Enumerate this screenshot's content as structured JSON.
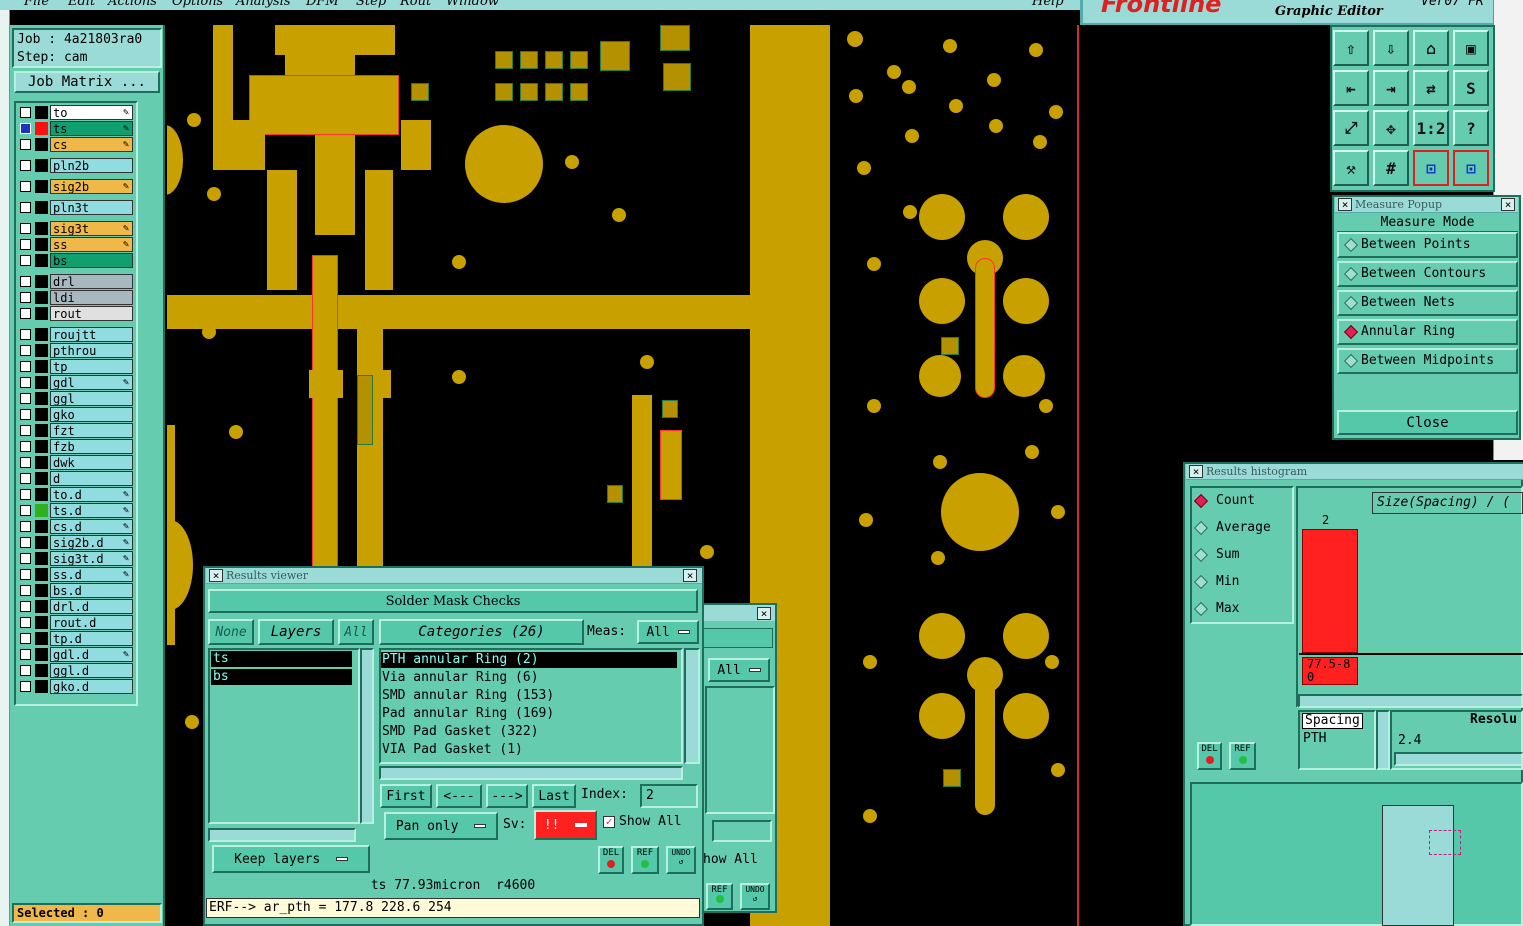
{
  "menu": {
    "items": [
      "File",
      "Edit",
      "Actions",
      "Options",
      "Analysis",
      "DFM",
      "Step",
      "Rout",
      "Window"
    ],
    "help": "Help",
    "brand": "Frontline",
    "brand_sub": "Graphic Editor",
    "version": "Ver07 FR"
  },
  "job": {
    "job_label": "Job : 4a21803ra0",
    "step_label": "Step: cam",
    "matrix_button": "Job Matrix ...",
    "selected": "Selected : 0"
  },
  "layers": [
    {
      "name": "to",
      "color": "#ffffff",
      "edit": true
    },
    {
      "name": "ts",
      "color": "#10a070",
      "edit": true,
      "selected": true
    },
    {
      "name": "cs",
      "color": "#f0b848",
      "edit": true
    },
    {
      "name": "pln2b",
      "color": "#90dce0",
      "edit": false
    },
    {
      "name": "sig2b",
      "color": "#f0b848",
      "edit": true
    },
    {
      "name": "pln3t",
      "color": "#90dce0",
      "edit": false
    },
    {
      "name": "sig3t",
      "color": "#f0b848",
      "edit": true
    },
    {
      "name": "ss",
      "color": "#f0b848",
      "edit": true
    },
    {
      "name": "bs",
      "color": "#10a070",
      "edit": false
    },
    {
      "name": "drl",
      "color": "#a8b8c0",
      "edit": false
    },
    {
      "name": "ldi",
      "color": "#a8b8c0",
      "edit": false
    },
    {
      "name": "rout",
      "color": "#e0e0e0",
      "edit": false
    },
    {
      "name": "roujtt",
      "color": "#90dce0",
      "edit": false
    },
    {
      "name": "pthrou",
      "color": "#90dce0",
      "edit": false
    },
    {
      "name": "tp",
      "color": "#90dce0",
      "edit": false
    },
    {
      "name": "gdl",
      "color": "#90dce0",
      "edit": true
    },
    {
      "name": "ggl",
      "color": "#90dce0",
      "edit": false
    },
    {
      "name": "gko",
      "color": "#90dce0",
      "edit": false
    },
    {
      "name": "fzt",
      "color": "#90dce0",
      "edit": false
    },
    {
      "name": "fzb",
      "color": "#90dce0",
      "edit": false
    },
    {
      "name": "dwk",
      "color": "#90dce0",
      "edit": false
    },
    {
      "name": "d",
      "color": "#90dce0",
      "edit": false
    },
    {
      "name": "to.d",
      "color": "#90dce0",
      "edit": true
    },
    {
      "name": "ts.d",
      "color": "#90dce0",
      "edit": true
    },
    {
      "name": "cs.d",
      "color": "#90dce0",
      "edit": true
    },
    {
      "name": "sig2b.d",
      "color": "#90dce0",
      "edit": true
    },
    {
      "name": "sig3t.d",
      "color": "#90dce0",
      "edit": true
    },
    {
      "name": "ss.d",
      "color": "#90dce0",
      "edit": true
    },
    {
      "name": "bs.d",
      "color": "#90dce0",
      "edit": false
    },
    {
      "name": "drl.d",
      "color": "#90dce0",
      "edit": false
    },
    {
      "name": "rout.d",
      "color": "#90dce0",
      "edit": false
    },
    {
      "name": "tp.d",
      "color": "#90dce0",
      "edit": false
    },
    {
      "name": "gdl.d",
      "color": "#90dce0",
      "edit": true
    },
    {
      "name": "ggl.d",
      "color": "#90dce0",
      "edit": false
    },
    {
      "name": "gko.d",
      "color": "#90dce0",
      "edit": false
    }
  ],
  "measure_popup": {
    "title": "Measure Popup",
    "header": "Measure Mode",
    "items": [
      {
        "label": "Between Points",
        "on": false
      },
      {
        "label": "Between Contours",
        "on": false
      },
      {
        "label": "Between Nets",
        "on": false
      },
      {
        "label": "Annular Ring",
        "on": true
      },
      {
        "label": "Between Midpoints",
        "on": false
      }
    ],
    "close": "Close"
  },
  "results_viewer": {
    "title": "Results viewer",
    "header": "Solder Mask Checks",
    "none": "None",
    "layers": "Layers",
    "all": "All",
    "categories": "Categories (26)",
    "meas_label": "Meas:",
    "meas_value": "All",
    "layer_list": [
      "ts",
      "bs"
    ],
    "category_list": [
      "PTH annular Ring (2)",
      "Via annular Ring (6)",
      "SMD annular Ring (153)",
      "Pad annular Ring (169)",
      "SMD Pad Gasket (322)",
      "VIA Pad Gasket (1)"
    ],
    "first": "First",
    "prev": "<---",
    "next": "--->",
    "last": "Last",
    "index_label": "Index:",
    "index_value": "2",
    "pan": "Pan only",
    "sv_label": "Sv:",
    "sv_value": "!!",
    "show_all": "Show All",
    "keep_layers": "Keep layers",
    "del": "DEL",
    "ref": "REF",
    "undo": "UNDO",
    "status": "ts 77.93micron  r4600",
    "erf": "ERF--> ar_pth = 177.8 228.6 254"
  },
  "behind_window": {
    "all": "All",
    "show_all": "how All",
    "ref": "REF",
    "undo": "UNDO"
  },
  "histogram": {
    "title": "Results histogram",
    "items": [
      {
        "label": "Count",
        "on": true
      },
      {
        "label": "Average",
        "on": false
      },
      {
        "label": "Sum",
        "on": false
      },
      {
        "label": "Min",
        "on": false
      },
      {
        "label": "Max",
        "on": false
      }
    ],
    "size_label": "Size(Spacing) / (",
    "bar_count": "2",
    "bar_range": "77.5-80",
    "bar_fraction": 1.0,
    "list": [
      "Spacing",
      "PTH"
    ],
    "resolution_label": "Resolu",
    "resolution_value": "2.4",
    "del": "DEL",
    "ref": "REF"
  },
  "toolbar_icons": [
    "home-up-icon",
    "home-down-icon",
    "house-icon",
    "window-icon",
    "left-icon",
    "right-icon",
    "flip-icon",
    "s-curve-icon",
    "fit-icon",
    "center-icon",
    "ratio-icon",
    "help-icon",
    "ruler-icon",
    "grid-icon",
    "net-left-icon",
    "net-right-icon"
  ],
  "toolbar_labels": {
    "ratio": "1:2",
    "help": "?"
  },
  "colors": {
    "copper": "#c8a000",
    "panel": "#66ccb0",
    "title": "#9adbd8",
    "red": "#ff2020"
  }
}
